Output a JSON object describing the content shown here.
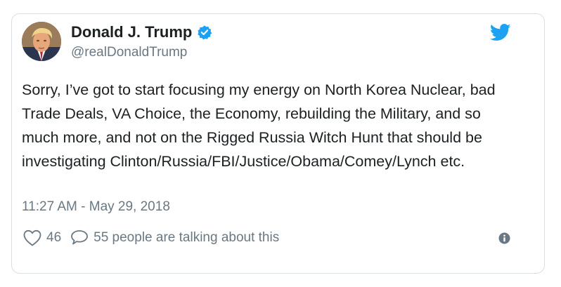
{
  "tweet": {
    "author_name": "Donald J. Trump",
    "handle": "@realDonaldTrump",
    "text": "Sorry, I’ve got to start focusing my energy on North Korea Nuclear, bad Trade Deals, VA Choice, the Economy, rebuilding the Military, and so much more, and not on the Rigged Russia Witch Hunt that should be investigating Clinton/Russia/FBI/Justice/Obama/Comey/Lynch etc.",
    "timestamp": "11:27 AM - May 29, 2018",
    "likes": "46",
    "talking": "55 people are talking about this",
    "verified": true
  },
  "icons": {
    "avatar": "profile-photo",
    "verified": "verified-badge-icon",
    "brand": "twitter-bird-icon",
    "like": "heart-icon",
    "reply": "speech-bubble-icon",
    "info": "info-icon"
  },
  "colors": {
    "brand_blue": "#1da1f2",
    "text": "#1c2022",
    "muted": "#697882",
    "border": "#d9dfe4"
  }
}
